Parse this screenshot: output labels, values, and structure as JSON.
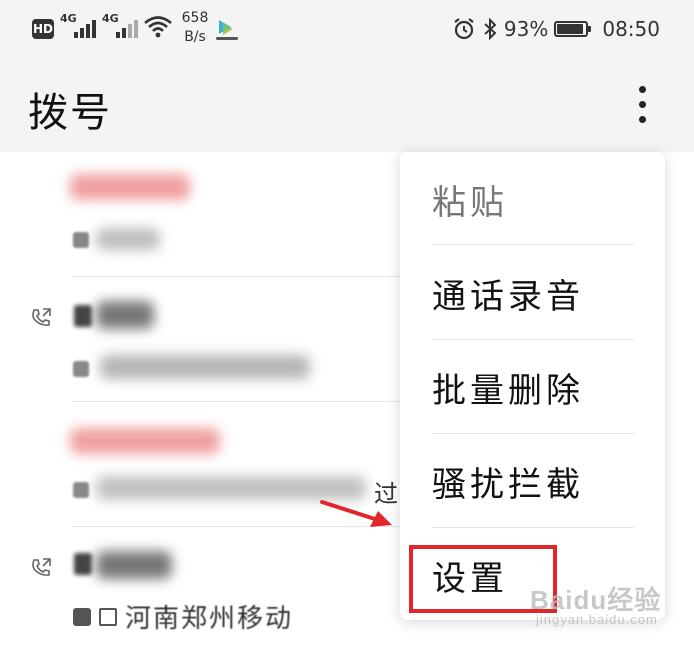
{
  "status_bar": {
    "hd_label": "HD",
    "network_1": "4G",
    "network_2": "4G",
    "speed_value": "658",
    "speed_unit": "B/s",
    "battery_percent": "93%",
    "time": "08:50",
    "icons": [
      "hd-icon",
      "signal-icon",
      "wifi-icon",
      "app-icon",
      "alarm-icon",
      "bluetooth-icon",
      "battery-icon"
    ]
  },
  "header": {
    "title": "拨号",
    "more_icon": "more-vertical-icon"
  },
  "call_log": {
    "partial_text": "过",
    "last_location": "河南郑州移动",
    "blur_colors": {
      "missed": "#e0262b",
      "normal": "#555555"
    }
  },
  "menu": {
    "items": [
      {
        "label": "粘贴",
        "enabled": false
      },
      {
        "label": "通话录音",
        "enabled": true
      },
      {
        "label": "批量删除",
        "enabled": true
      },
      {
        "label": "骚扰拦截",
        "enabled": true
      },
      {
        "label": "设置",
        "enabled": true
      }
    ]
  },
  "annotation": {
    "highlight_color": "#e0262b",
    "watermark_main": "Baidu经验",
    "watermark_sub": "jingyan.baidu.com"
  }
}
